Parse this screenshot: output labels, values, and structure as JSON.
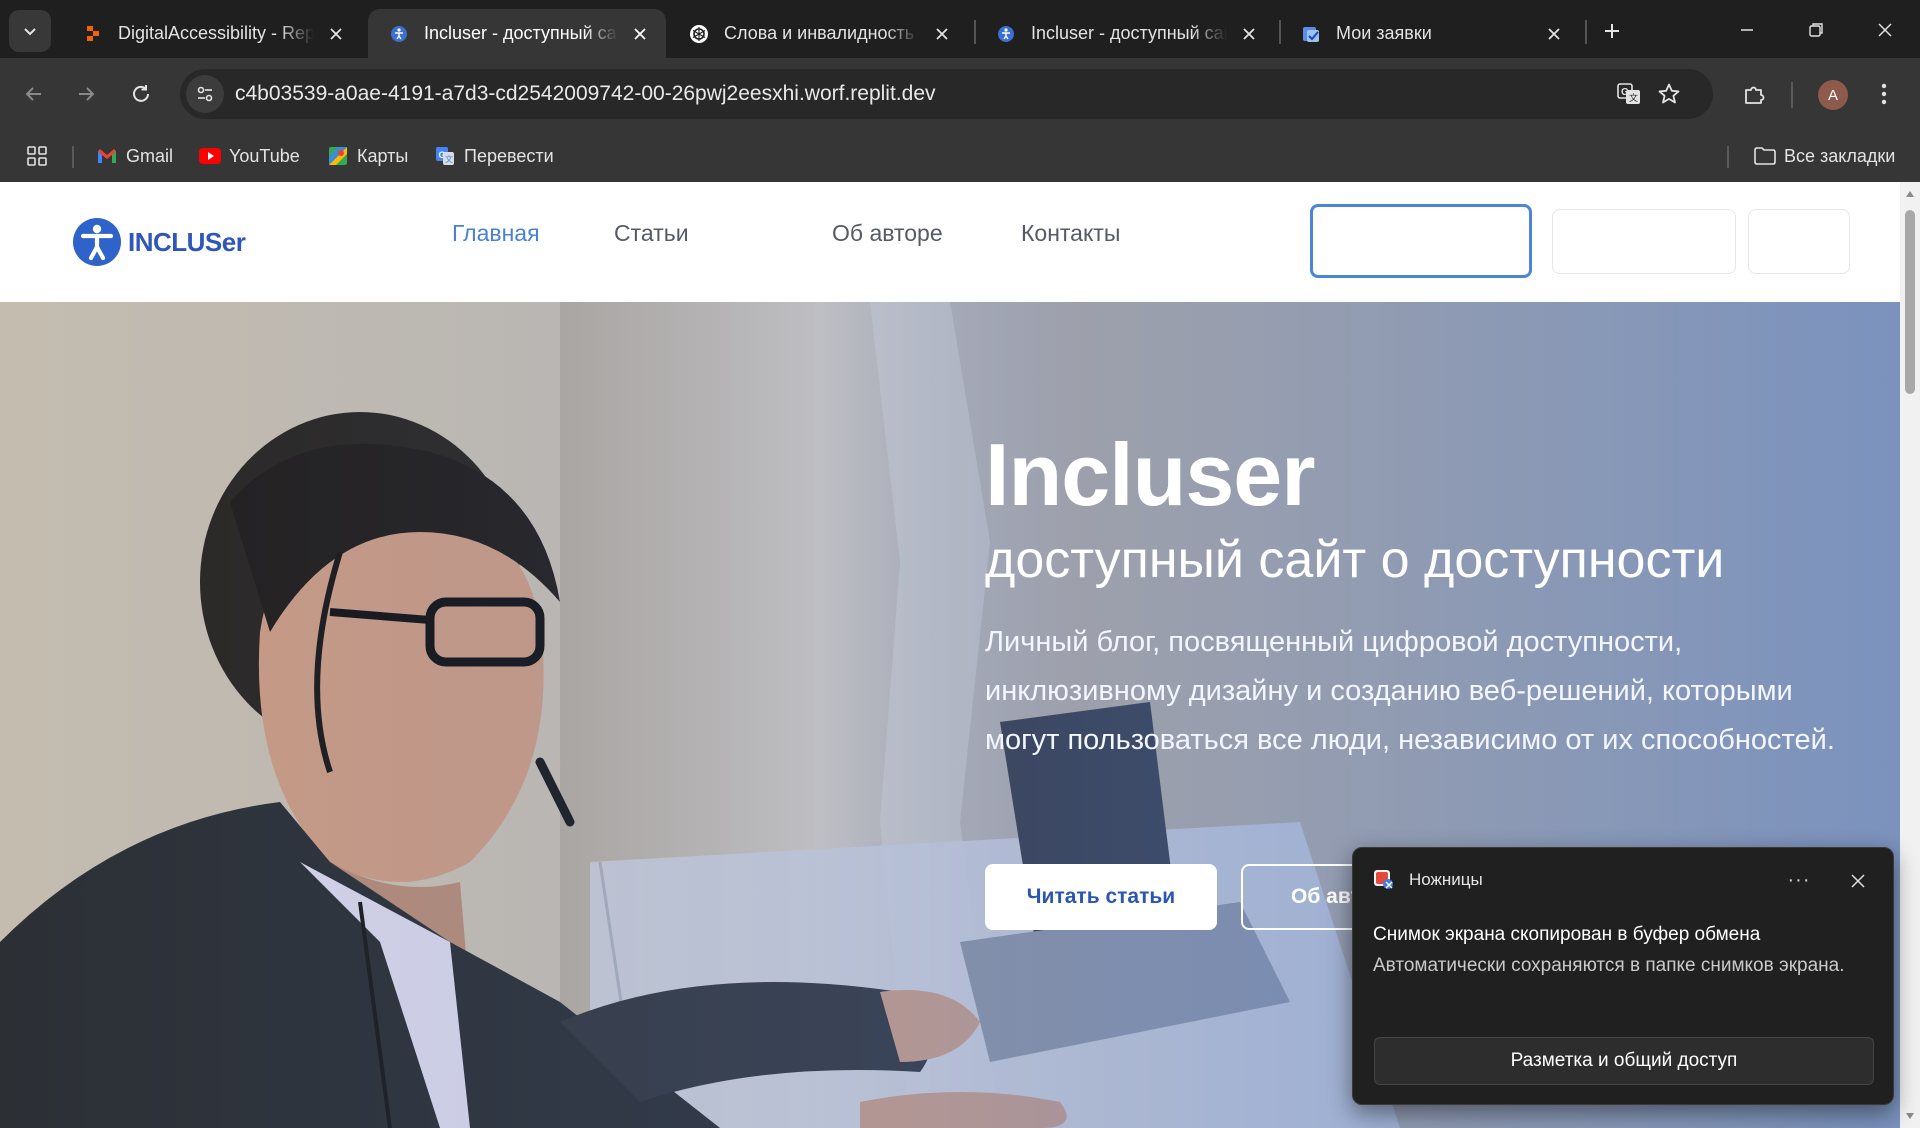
{
  "tabs": [
    {
      "title": "DigitalAccessibility - Repl",
      "favicon": "replit-icon",
      "active": false
    },
    {
      "title": "Incluser - доступный сай",
      "favicon": "incluser-favicon",
      "active": true
    },
    {
      "title": "Слова и инвалидность",
      "favicon": "chatgpt-icon",
      "active": false
    },
    {
      "title": "Incluser - доступный сай",
      "favicon": "incluser-favicon",
      "active": false
    },
    {
      "title": "Мои заявки",
      "favicon": "tasks-icon",
      "active": false
    }
  ],
  "address_bar": {
    "url": "c4b03539-a0ae-4191-a7d3-cd2542009742-00-26pwj2eesxhi.worf.replit.dev"
  },
  "profile": {
    "initial": "A"
  },
  "bookmarks": {
    "items": [
      {
        "label": "Gmail",
        "icon": "gmail-icon"
      },
      {
        "label": "YouTube",
        "icon": "youtube-icon"
      },
      {
        "label": "Карты",
        "icon": "maps-icon"
      },
      {
        "label": "Перевести",
        "icon": "translate-icon"
      }
    ],
    "all_bookmarks": "Все закладки"
  },
  "site": {
    "logo_text": "INCLUSer",
    "nav": [
      "Главная",
      "Статьи",
      "Об авторе",
      "Контакты"
    ],
    "nav_current": 0
  },
  "hero": {
    "title": "Incluser",
    "subtitle": "доступный сайт о доступности",
    "description": "Личный блог, посвященный цифровой доступности, инклюзивному дизайну и созданию веб-решений, которыми могут пользоваться все люди, независимо от их способностей.",
    "primary_button": "Читать статьи",
    "secondary_button": "Об авторе"
  },
  "toast": {
    "app_name": "Ножницы",
    "more": "···",
    "title": "Снимок экрана скопирован в буфер обмена",
    "body": "Автоматически сохраняются в папке снимков экрана.",
    "action": "Разметка и общий доступ"
  },
  "colors": {
    "accent": "#4a80d6",
    "brand": "#2f57b8",
    "hero_gradient_end": "#4d7fd6"
  }
}
